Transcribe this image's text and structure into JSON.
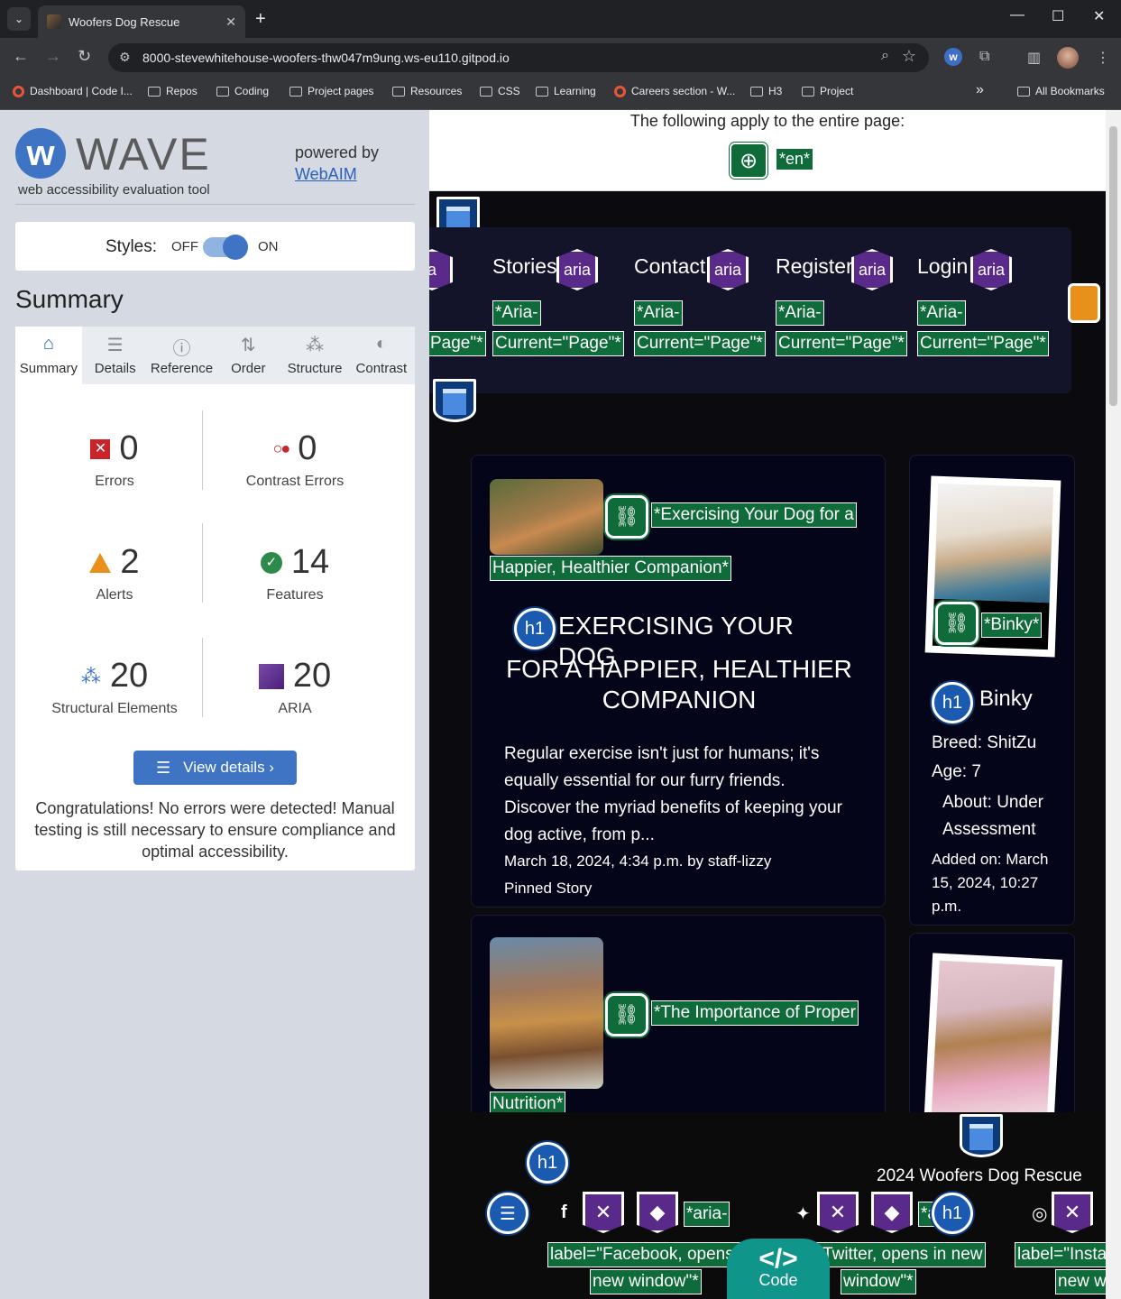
{
  "browser": {
    "tab_title": "Woofers Dog Rescue",
    "url": "8000-stevewhitehouse-woofers-thw047m9ung.ws-eu110.gitpod.io",
    "bookmarks": [
      "Dashboard | Code I...",
      "Repos",
      "Coding",
      "Project pages",
      "Resources",
      "CSS",
      "Learning",
      "Careers section - W...",
      "H3",
      "Project"
    ],
    "more": "»",
    "all_bookmarks": "All Bookmarks"
  },
  "wave": {
    "title": "WAVE",
    "subtitle": "web accessibility evaluation tool",
    "powered_by": "powered by",
    "webaim": "WebAIM",
    "styles_label": "Styles:",
    "styles_off": "OFF",
    "styles_on": "ON",
    "summary_heading": "Summary",
    "tabs": [
      "Summary",
      "Details",
      "Reference",
      "Order",
      "Structure",
      "Contrast"
    ],
    "stats": {
      "errors": {
        "value": "0",
        "label": "Errors"
      },
      "contrast": {
        "value": "0",
        "label": "Contrast Errors"
      },
      "alerts": {
        "value": "2",
        "label": "Alerts"
      },
      "features": {
        "value": "14",
        "label": "Features"
      },
      "structural": {
        "value": "20",
        "label": "Structural Elements"
      },
      "aria": {
        "value": "20",
        "label": "ARIA"
      }
    },
    "view_details": "View details ›",
    "congrats": "Congratulations! No errors were detected! Manual testing is still necessary to ensure compliance and optimal accessibility."
  },
  "page": {
    "apply_text": "The following apply to the entire page:",
    "lang_tag": "*en*",
    "nav": [
      "Stories",
      "Contact",
      "Register",
      "Login"
    ],
    "aria_badge": "aria",
    "aria_current_1": "*Aria-",
    "aria_current_2": "Current=\"Page\"*",
    "aria_current_partial": "Page\"*",
    "aria_partial": "a",
    "story1": {
      "alt_1": "*Exercising Your Dog for a",
      "alt_2": "Happier, Healthier Companion*",
      "title_1": "EXERCISING YOUR DOG",
      "title_2": "FOR A HAPPIER, HEALTHIER",
      "title_3": "COMPANION",
      "excerpt": [
        "Regular exercise isn't just for humans; it's",
        "equally essential for our furry friends.",
        "Discover the myriad benefits of keeping your",
        "dog active, from p..."
      ],
      "date": "March 18, 2024, 4:34 p.m. by staff-lizzy",
      "pinned": "Pinned Story"
    },
    "story2": {
      "alt_1": "*The Importance of Proper",
      "alt_2": "Nutrition*"
    },
    "dog1": {
      "alt": "*Binky*",
      "name": "Binky",
      "breed": "Breed: ShitZu",
      "age": "Age: 7",
      "about_1": "About: Under",
      "about_2": "Assessment",
      "added_1": "Added on: March",
      "added_2": "15, 2024, 10:27",
      "added_3": "p.m."
    },
    "h1_badge": "h1",
    "footer": {
      "copyright": "2024 Woofers Dog Rescue",
      "fb_1": "*aria-",
      "fb_2": "label=\"Facebook, opens in",
      "fb_3": "new window\"*",
      "tw_1": "*a",
      "tw_2": "l=\"Twitter, opens in new",
      "tw_3": "window\"*",
      "ig_2": "label=\"Instag",
      "ig_3": "new w"
    },
    "code_label": "Code",
    "code_symbol": "</>"
  }
}
